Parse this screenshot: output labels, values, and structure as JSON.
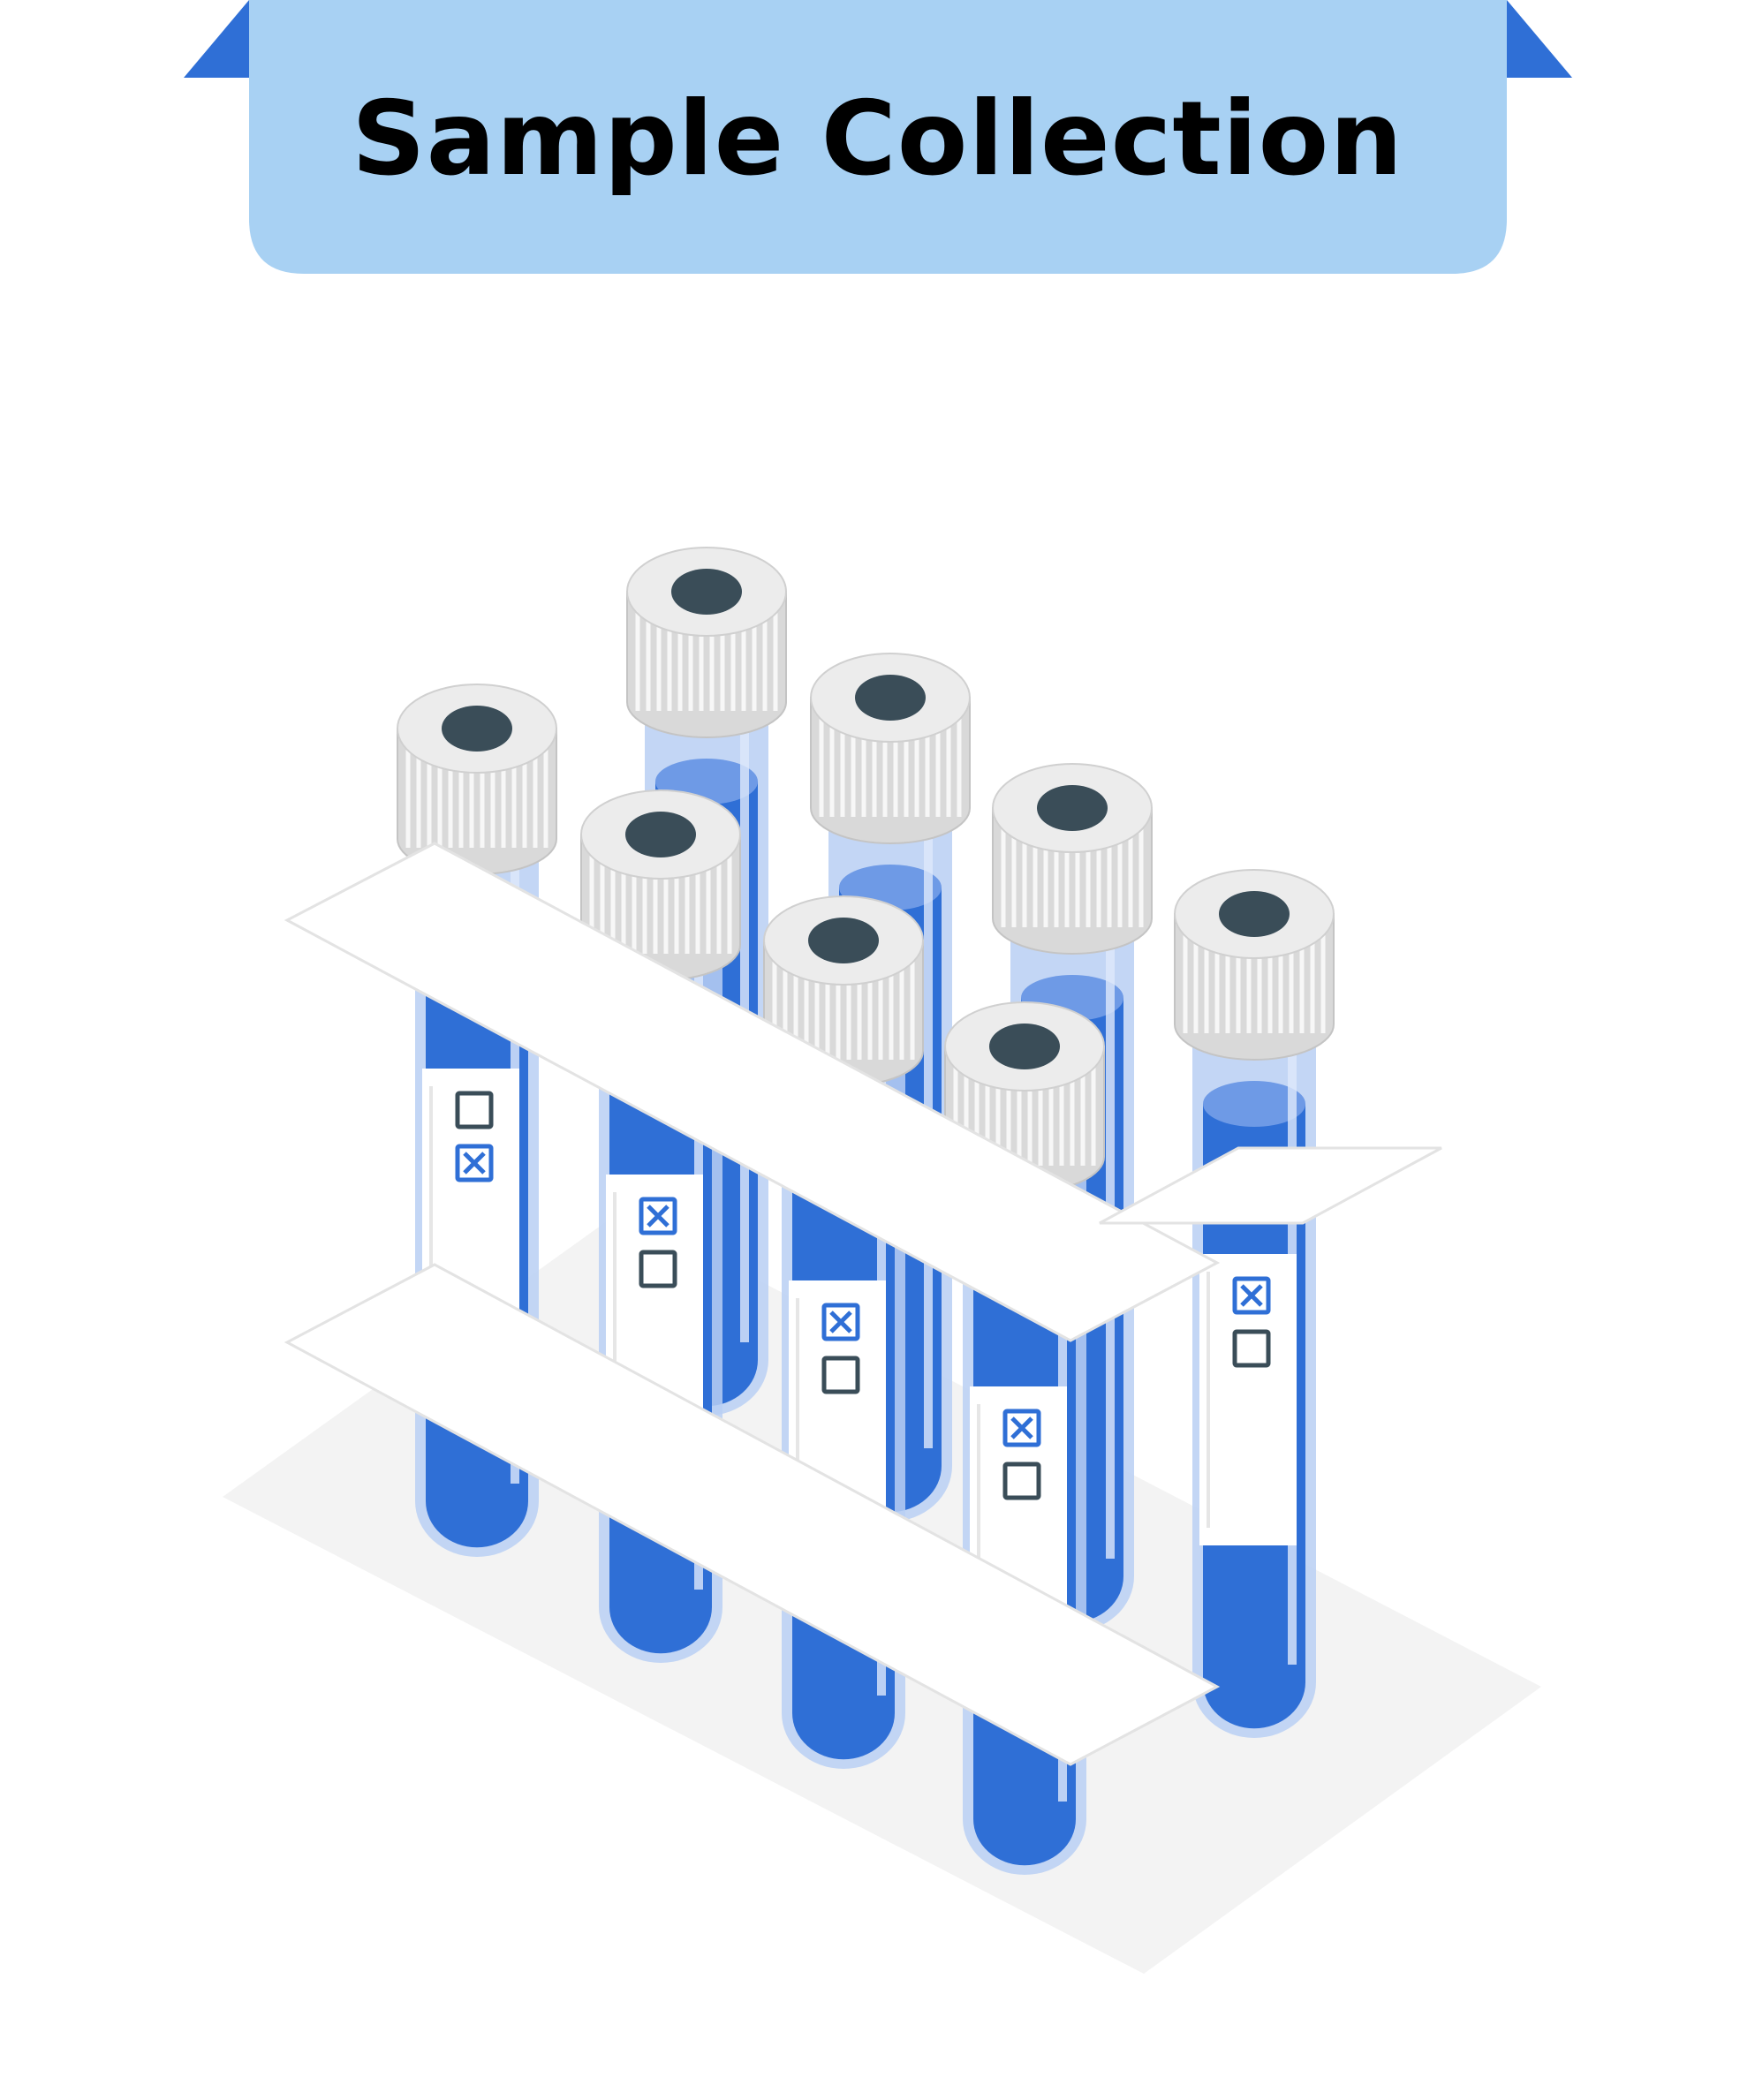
{
  "banner": {
    "title": "Sample Collection",
    "fill_color": "#a8d1f3",
    "ribbon_color": "#2f6fd6"
  },
  "illustration": {
    "subject": "test tube rack with sample tubes",
    "tube_count": 8,
    "colors": {
      "liquid": "#2f6fd6",
      "glass": "#b9cff3",
      "cap": "#e2e2e2",
      "cap_hole": "#3a4d58",
      "rack": "#ffffff",
      "shadow": "#f2f2f2"
    },
    "label_checkboxes": [
      {
        "tube": "front-left",
        "top_checked": false,
        "bottom_checked": true
      },
      {
        "tube": "front-middle-left",
        "top_checked": true,
        "bottom_checked": false
      },
      {
        "tube": "front-middle-right",
        "top_checked": true,
        "bottom_checked": false
      },
      {
        "tube": "front-right",
        "top_checked": true,
        "bottom_checked": false
      },
      {
        "tube": "back-right",
        "top_checked": true,
        "bottom_checked": false
      }
    ]
  }
}
